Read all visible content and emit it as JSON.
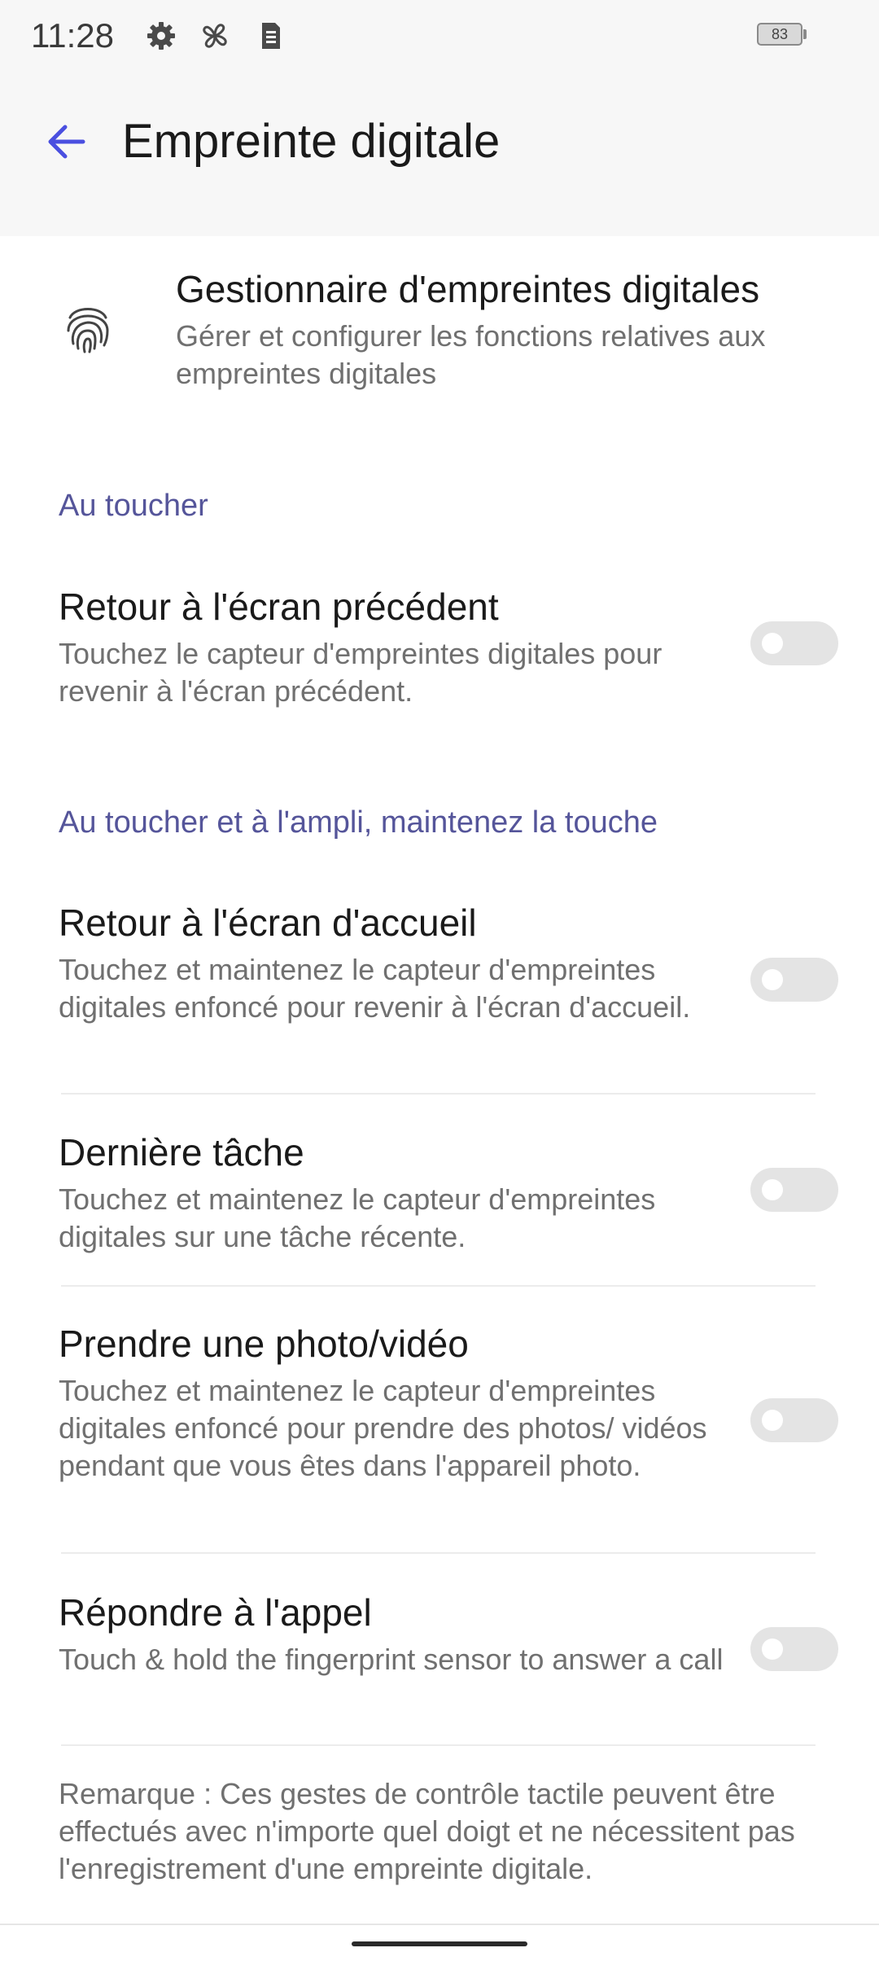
{
  "status_bar": {
    "time": "11:28",
    "battery": "83",
    "icons": [
      "gear-icon",
      "pinwheel-icon",
      "sim-card-icon"
    ]
  },
  "header": {
    "title": "Empreinte digitale",
    "back_icon": "arrow-left-icon"
  },
  "manager": {
    "icon": "fingerprint-icon",
    "title": "Gestionnaire d'empreintes digitales",
    "description": "Gérer et configurer les fonctions relatives aux empreintes digitales"
  },
  "sections": [
    {
      "header": "Au toucher",
      "items": [
        {
          "title": "Retour à l'écran précédent",
          "description": "Touchez le capteur d'empreintes digitales pour revenir à l'écran précédent.",
          "enabled": false
        }
      ]
    },
    {
      "header": "Au toucher et à l'ampli, maintenez la touche",
      "items": [
        {
          "title": "Retour à l'écran d'accueil",
          "description": "Touchez et maintenez le capteur d'empreintes digitales enfoncé pour revenir à l'écran d'accueil.",
          "enabled": false
        },
        {
          "title": "Dernière tâche",
          "description": "Touchez et maintenez le capteur d'empreintes digitales sur une tâche récente.",
          "enabled": false
        },
        {
          "title": "Prendre une photo/vidéo",
          "description": "Touchez et maintenez le capteur d'empreintes digitales enfoncé pour prendre des photos/ vidéos pendant que vous êtes dans l'appareil photo.",
          "enabled": false
        },
        {
          "title": "Répondre à l'appel",
          "description": "Touch & hold the fingerprint sensor to answer a call",
          "enabled": false
        }
      ]
    }
  ],
  "note": "Remarque : Ces gestes de contrôle tactile peuvent être effectués avec n'importe quel doigt et ne nécessitent pas l'enregistrement d'une empreinte digitale.",
  "colors": {
    "accent": "#4a4fe0",
    "section_header": "#55559a",
    "toggle_off": "#e4e4e4"
  }
}
